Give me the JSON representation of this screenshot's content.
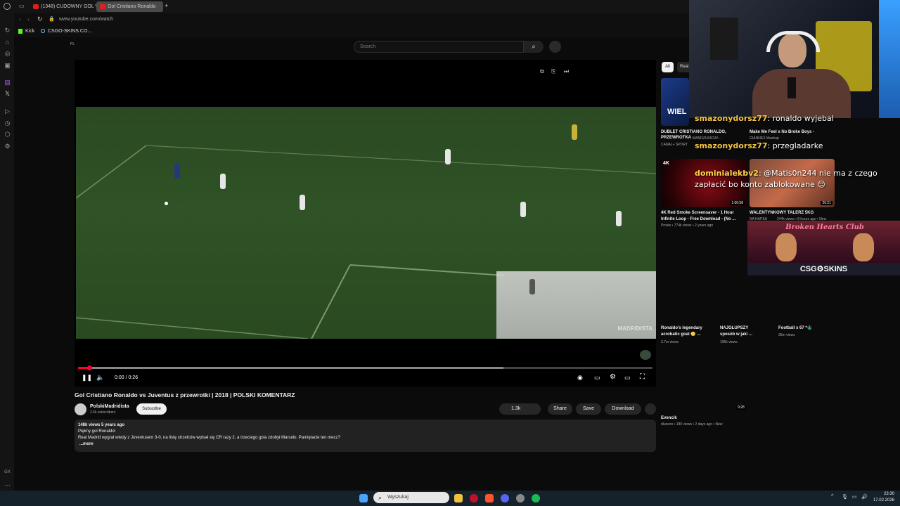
{
  "browser": {
    "tabs": [
      {
        "label": "(1348) CUDOWNY GOL VI"
      },
      {
        "label": "Gol Cristiano Ronaldo"
      }
    ],
    "url": "www.youtube.com/watch",
    "bookmarks": [
      {
        "label": "Kick"
      },
      {
        "label": "CSGO-SKINS.CO..."
      }
    ]
  },
  "youtube": {
    "locale": "PL",
    "search_placeholder": "Search",
    "video": {
      "time": "0:00 / 0:26",
      "watermark": "MADRIDISTA",
      "progress": 0.02,
      "buffered": 0.74
    },
    "title": "Gol Cristiano Ronaldo vs Juventus z przewrotki | 2018 | POLSKI KOMENTARZ",
    "channel": {
      "name": "PolskiMadridista",
      "subs": "2.6k subscribers",
      "subscribe": "Subscribe"
    },
    "actions": {
      "likes": "1.3k",
      "share": "Share",
      "save": "Save",
      "download": "Download"
    },
    "description": {
      "meta": "148k views  5 years ago",
      "line1": "Piękny gol Ronaldo!",
      "line2": "Real Madrid wygrał wtedy z Juventusem 3-0, na listę strzelców wpisał się CR razy 2, a trzeciego gola zdobył Marcelo. Pamiętacie ten mecz?",
      "more": "...more"
    },
    "chips": [
      {
        "label": "All"
      },
      {
        "label": "Real"
      }
    ],
    "recs": [
      {
        "title1": "DUBLET CRISTIANO RONALDO,",
        "title2": "PRZEWROTKA",
        "title2b": "MANDZUKICIA!...",
        "meta": "CANAL+ SPORT",
        "thumb_text": "WIEL"
      },
      {
        "title1": "Make Me Feel x No Broke Boys -",
        "title2": "GIANNEX Mashup",
        "meta": ""
      },
      {
        "title1": "4K Red Smoke Screensaver - 1 Hour",
        "title2": "Infinite Loop -  Free Download - (No ...",
        "meta": "Proias • 774k views • 2 years ago",
        "duration": "1:00:58",
        "badge": "4K"
      },
      {
        "title1": "WALENTYNKOWY TALERZ 5KG",
        "title2": "NA HAPSA",
        "meta": "244k views • 8 hours ago • New",
        "duration": "26:21"
      }
    ],
    "shorts": [
      {
        "title1": "Ronaldo's legendary",
        "title2": "acrobatic goal 😳 ...",
        "meta": "3.7m views"
      },
      {
        "title1": "NAJGŁUPSZY",
        "title2": "sposób w jaki ...",
        "meta": "196k views"
      },
      {
        "title1": "Football x 67 *🤹‍♂️",
        "title2": "",
        "meta": "35m views"
      }
    ],
    "rec_last": {
      "duration": "9:28",
      "title": "Evencik",
      "meta": "dlusson • 180 views • 2 days ago • New"
    }
  },
  "overlay": {
    "chat": [
      {
        "user": "smazonydorsz77",
        "text": "ronaldo wyjebal"
      },
      {
        "user": "smazonydorsz77",
        "text": "przegladarke"
      },
      {
        "user": "dominialekbv2",
        "text": "@Matis0n244 nie ma z czego",
        "text2": "zapłacić bo konto zablokowane 😔"
      }
    ],
    "sponsor": {
      "club": "Broken Hearts Club",
      "brand": "CSG⚙SKINS"
    }
  },
  "taskbar": {
    "search": "Wyszukaj",
    "time": "23:30",
    "date": "17.02.2026"
  },
  "colors": {
    "accent": "#ff0033",
    "chat_user": "#f5c542"
  }
}
